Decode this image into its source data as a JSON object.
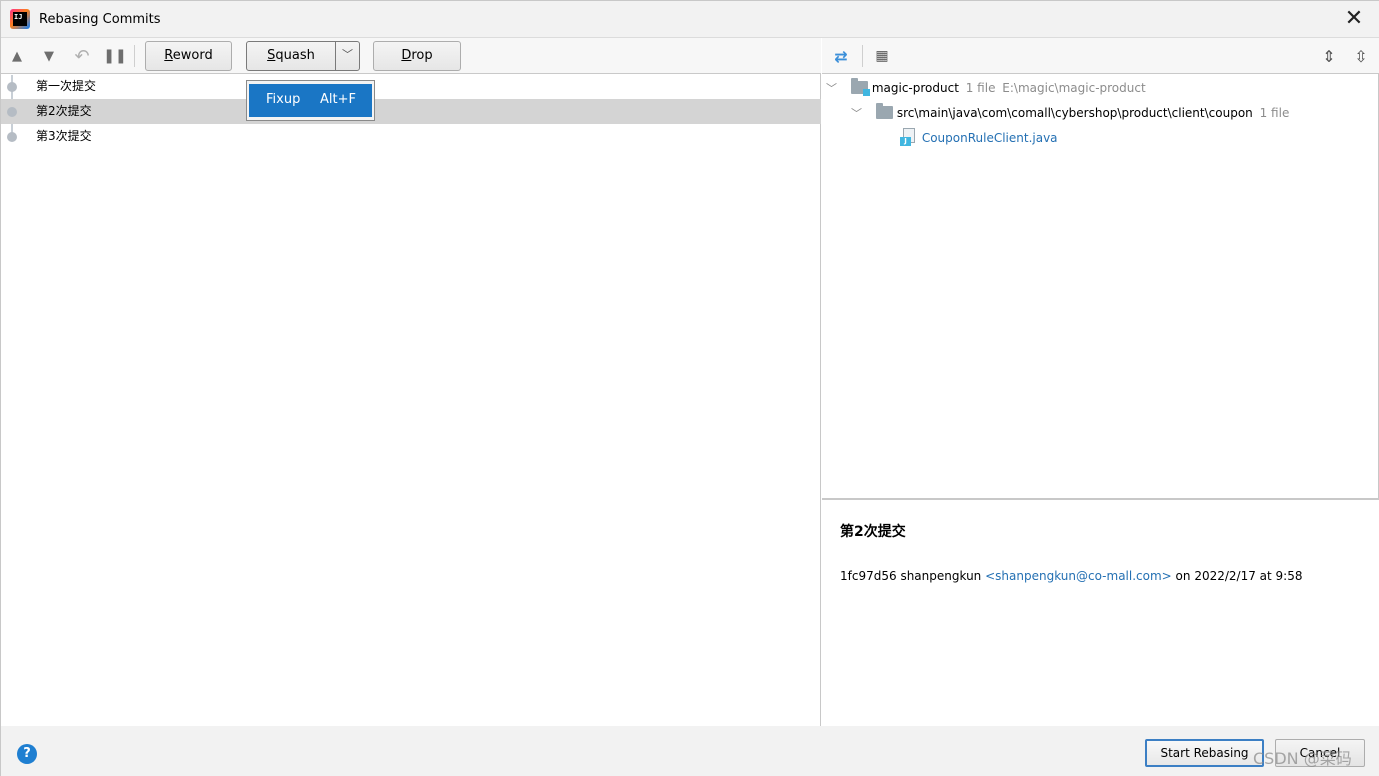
{
  "window": {
    "title": "Rebasing Commits"
  },
  "toolbar": {
    "reword": {
      "prefix": "",
      "underline": "R",
      "suffix": "eword"
    },
    "squash": {
      "prefix": "",
      "underline": "S",
      "suffix": "quash"
    },
    "drop": {
      "prefix": "",
      "underline": "D",
      "suffix": "rop"
    }
  },
  "commits": [
    {
      "label": "第一次提交",
      "selected": false
    },
    {
      "label": "第2次提交",
      "selected": true
    },
    {
      "label": "第3次提交",
      "selected": false
    }
  ],
  "popup": {
    "item": "Fixup",
    "shortcut": "Alt+F"
  },
  "file_tree": {
    "root": {
      "name": "magic-product",
      "count": "1 file",
      "path": "E:\\magic\\magic-product"
    },
    "package": {
      "name": "src\\main\\java\\com\\comall\\cybershop\\product\\client\\coupon",
      "count": "1 file"
    },
    "file": {
      "name": "CouponRuleClient.java"
    }
  },
  "details": {
    "title": "第2次提交",
    "hash": "1fc97d56",
    "author": "shanpengkun",
    "email": "<shanpengkun@co-mall.com>",
    "date_prefix": "on",
    "date": "2022/2/17 at 9:58"
  },
  "buttons": {
    "start": "Start Rebasing",
    "cancel": "Cancel",
    "help": "?"
  },
  "watermark": "CSDN @菜码",
  "colors": {
    "accent": "#1a76c5",
    "selection": "#d4d4d4",
    "link": "#2470b3"
  }
}
